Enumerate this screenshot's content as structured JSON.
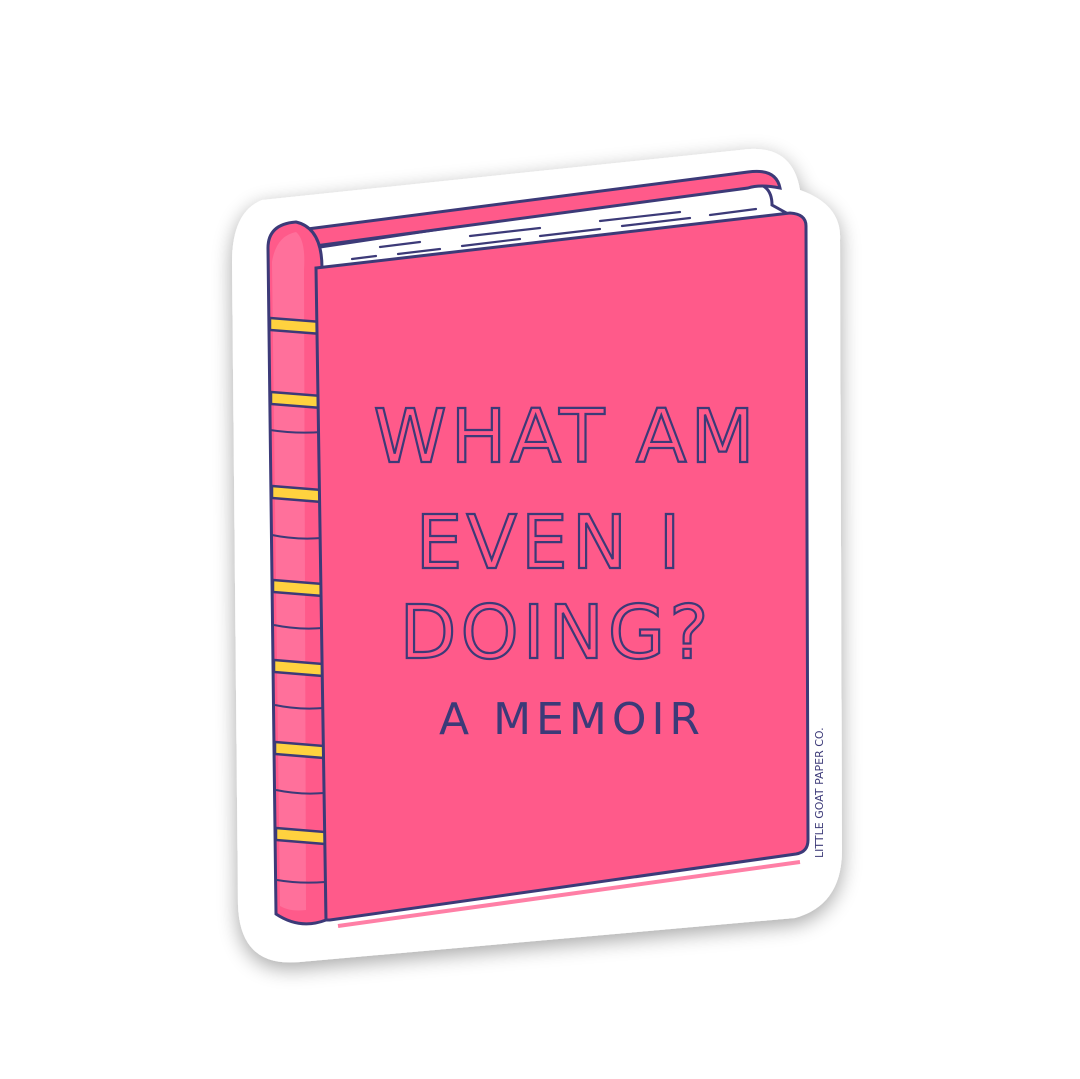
{
  "sticker": {
    "cover_lines": [
      "WHAT AM",
      "EVEN I",
      "DOING?"
    ],
    "subtitle": "A MEMOIR",
    "brand_mark": "LITTLE GOAT PAPER CO."
  },
  "colors": {
    "cover_pink": "#FF5A8A",
    "cover_pink_light": "#FF7FA6",
    "outline_navy": "#3C3A78",
    "spine_band_yellow": "#FFD23F",
    "pages_white": "#FFFFFF",
    "sticker_border": "#FFFFFF",
    "sticker_shadow": "#D9D9D9",
    "background": "#FFFFFF"
  },
  "icons": [
    "book-icon"
  ]
}
